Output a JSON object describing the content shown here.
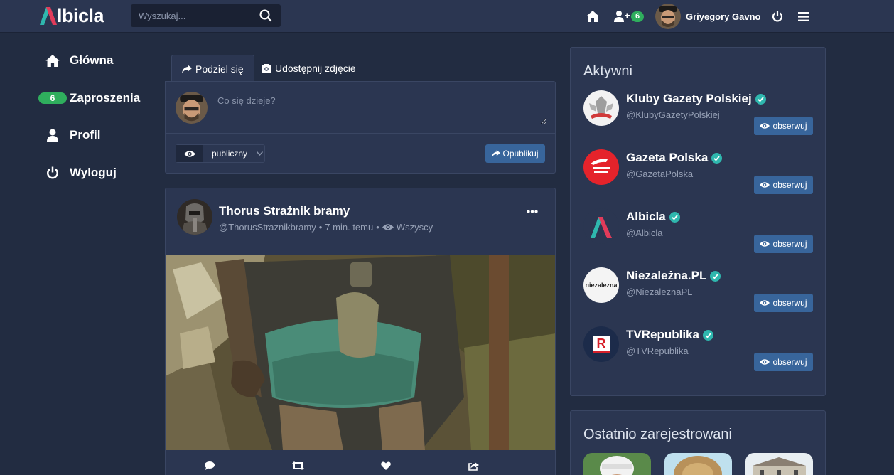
{
  "brand": {
    "name": "lbicla",
    "accent": "#2fae5d",
    "link_blue": "#38659b",
    "verified": "#2fb7ae"
  },
  "search": {
    "placeholder": "Wyszukaj..."
  },
  "header": {
    "icons": [
      "home-icon",
      "user-plus-icon",
      "power-icon",
      "menu-icon"
    ],
    "invite_count": "6",
    "user_name": "Griyegory Gavno"
  },
  "sidebar": {
    "items": [
      {
        "label": "Główna",
        "icon": "home-icon"
      },
      {
        "label": "Zaproszenia",
        "badge": "6"
      },
      {
        "label": "Profil",
        "icon": "user-icon"
      },
      {
        "label": "Wyloguj",
        "icon": "power-icon"
      }
    ]
  },
  "composer": {
    "tabs": [
      {
        "label": "Podziel się",
        "icon": "share-icon"
      },
      {
        "label": "Udostępnij zdjęcie",
        "icon": "camera-icon"
      }
    ],
    "placeholder": "Co się dzieje?",
    "visibility": "publiczny",
    "publish_label": "Opublikuj"
  },
  "post": {
    "author": "Thorus Strażnik bramy",
    "handle": "@ThorusStraznikbramy",
    "time": "7 min. temu",
    "audience": "Wszyscy",
    "actions": [
      "comment-icon",
      "repost-icon",
      "like-icon",
      "share-icon"
    ]
  },
  "active_panel": {
    "title": "Aktywni",
    "follow_label": "obserwuj",
    "accounts": [
      {
        "name": "Kluby Gazety Polskiej",
        "handle": "@KlubyGazetyPolskiej"
      },
      {
        "name": "Gazeta Polska",
        "handle": "@GazetaPolska"
      },
      {
        "name": "Albicla",
        "handle": "@Albicla"
      },
      {
        "name": "Niezależna.PL",
        "handle": "@NiezaleznaPL",
        "logo_text": "niezalezna"
      },
      {
        "name": "TVRepublika",
        "handle": "@TVRepublika",
        "logo_text": "R"
      }
    ]
  },
  "recent_panel": {
    "title": "Ostatnio zarejestrowani"
  }
}
